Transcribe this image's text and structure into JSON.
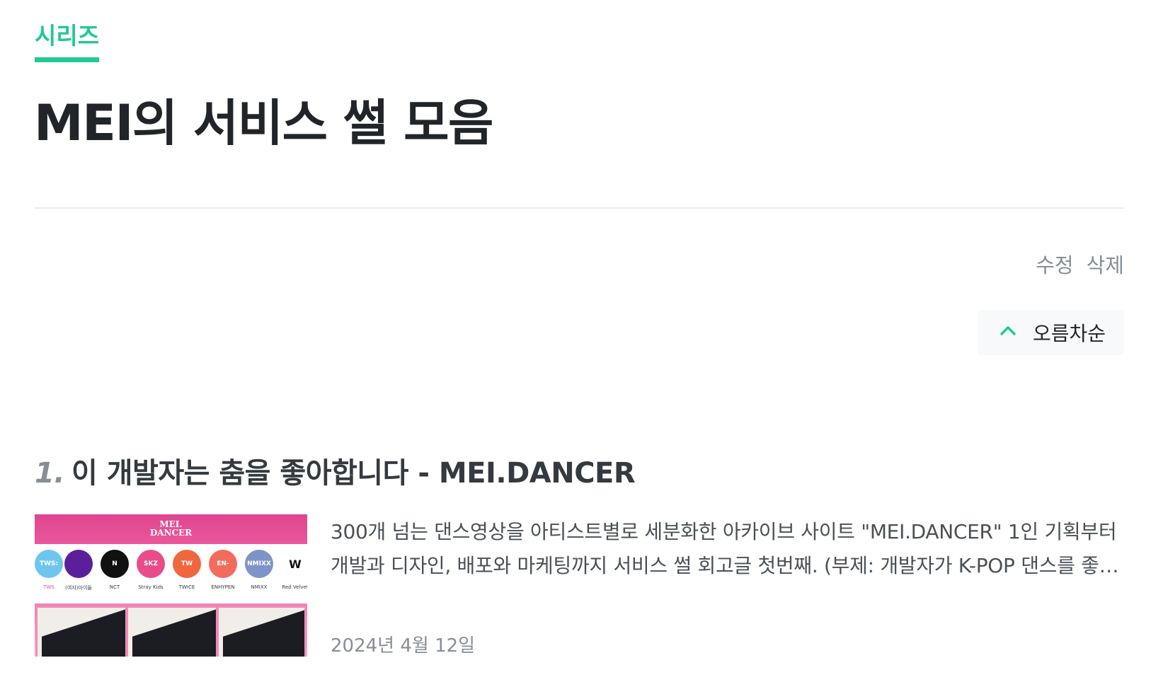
{
  "header": {
    "tab_label": "시리즈",
    "title": "MEI의 서비스 썰 모음"
  },
  "actions": {
    "edit_label": "수정",
    "delete_label": "삭제"
  },
  "sort": {
    "label": "오름차순",
    "icon": "chevron-up-icon"
  },
  "accent_color": "#20c997",
  "posts": [
    {
      "number": "1.",
      "title": "이 개발자는 춤을 좋아합니다 - MEI.DANCER",
      "excerpt": "300개 넘는 댄스영상을 아티스트별로 세분화한 아카이브 사이트 \"MEI.DANCER\" 1인 기획부터 개발과 디자인, 배포와 마케팅까지 서비스 썰 회고글 첫번째. (부제: 개발자가 K-POP 댄스를 좋아하면 생기는 일)",
      "date": "2024년 4월 12일",
      "thumbnail": {
        "logo_line1": "MEI.",
        "logo_line2": "DANCER",
        "artists": [
          {
            "name": "TWS",
            "badge": "TWS:",
            "color": "#6ec6f0"
          },
          {
            "name": "(여자)아이들",
            "badge": "",
            "color": "#5b1f9c"
          },
          {
            "name": "NCT",
            "badge": "N",
            "color": "#111111"
          },
          {
            "name": "Stray Kids",
            "badge": "SKZ",
            "color": "#e84d8a"
          },
          {
            "name": "TWICE",
            "badge": "TW",
            "color": "#f0663f"
          },
          {
            "name": "ENHYPEN",
            "badge": "EN-",
            "color": "#f26b5b"
          },
          {
            "name": "NMIXX",
            "badge": "NMIXX",
            "color": "#7e93c8"
          },
          {
            "name": "Red Velvet",
            "badge": "W",
            "color": "#ffffff"
          }
        ]
      }
    }
  ]
}
